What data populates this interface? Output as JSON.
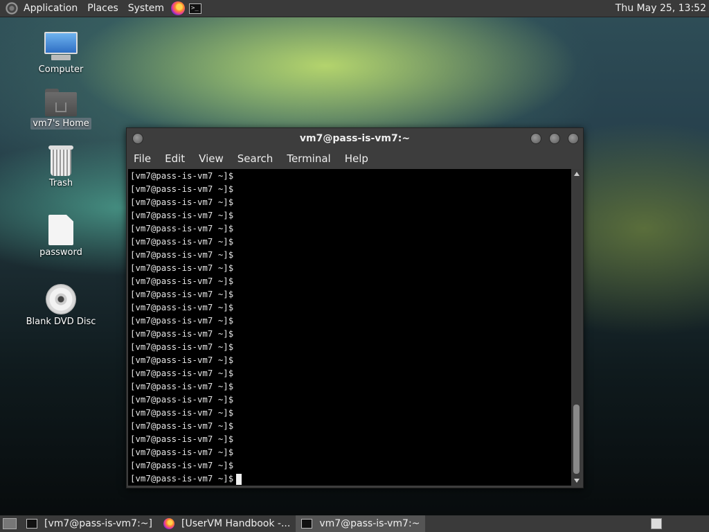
{
  "top_panel": {
    "menus": [
      "Application",
      "Places",
      "System"
    ],
    "launchers": [
      "firefox-icon",
      "terminal-icon"
    ],
    "clock": "Thu May 25, 13:52"
  },
  "desktop_icons": [
    {
      "label": "Computer",
      "icon": "computer-icon"
    },
    {
      "label": "vm7's Home",
      "icon": "home-folder-icon"
    },
    {
      "label": "Trash",
      "icon": "trash-icon"
    },
    {
      "label": "password",
      "icon": "file-icon"
    },
    {
      "label": "Blank DVD Disc",
      "icon": "dvd-icon"
    }
  ],
  "terminal": {
    "title": "vm7@pass-is-vm7:~",
    "menu": [
      "File",
      "Edit",
      "View",
      "Search",
      "Terminal",
      "Help"
    ],
    "prompt": "[vm7@pass-is-vm7 ~]$",
    "lines": [
      "[vm7@pass-is-vm7 ~]$",
      "[vm7@pass-is-vm7 ~]$",
      "[vm7@pass-is-vm7 ~]$",
      "[vm7@pass-is-vm7 ~]$",
      "[vm7@pass-is-vm7 ~]$",
      "[vm7@pass-is-vm7 ~]$",
      "[vm7@pass-is-vm7 ~]$",
      "[vm7@pass-is-vm7 ~]$",
      "[vm7@pass-is-vm7 ~]$",
      "[vm7@pass-is-vm7 ~]$",
      "[vm7@pass-is-vm7 ~]$",
      "[vm7@pass-is-vm7 ~]$",
      "[vm7@pass-is-vm7 ~]$",
      "[vm7@pass-is-vm7 ~]$",
      "[vm7@pass-is-vm7 ~]$",
      "[vm7@pass-is-vm7 ~]$",
      "[vm7@pass-is-vm7 ~]$",
      "[vm7@pass-is-vm7 ~]$",
      "[vm7@pass-is-vm7 ~]$",
      "[vm7@pass-is-vm7 ~]$",
      "[vm7@pass-is-vm7 ~]$",
      "[vm7@pass-is-vm7 ~]$",
      "[vm7@pass-is-vm7 ~]$",
      "[vm7@pass-is-vm7 ~]$"
    ]
  },
  "taskbar": {
    "tasks": [
      {
        "label": "[vm7@pass-is-vm7:~]",
        "icon": "terminal-icon",
        "active": false
      },
      {
        "label": "[UserVM Handbook -...",
        "icon": "firefox-icon",
        "active": false
      },
      {
        "label": "vm7@pass-is-vm7:~",
        "icon": "terminal-icon",
        "active": true
      }
    ]
  }
}
